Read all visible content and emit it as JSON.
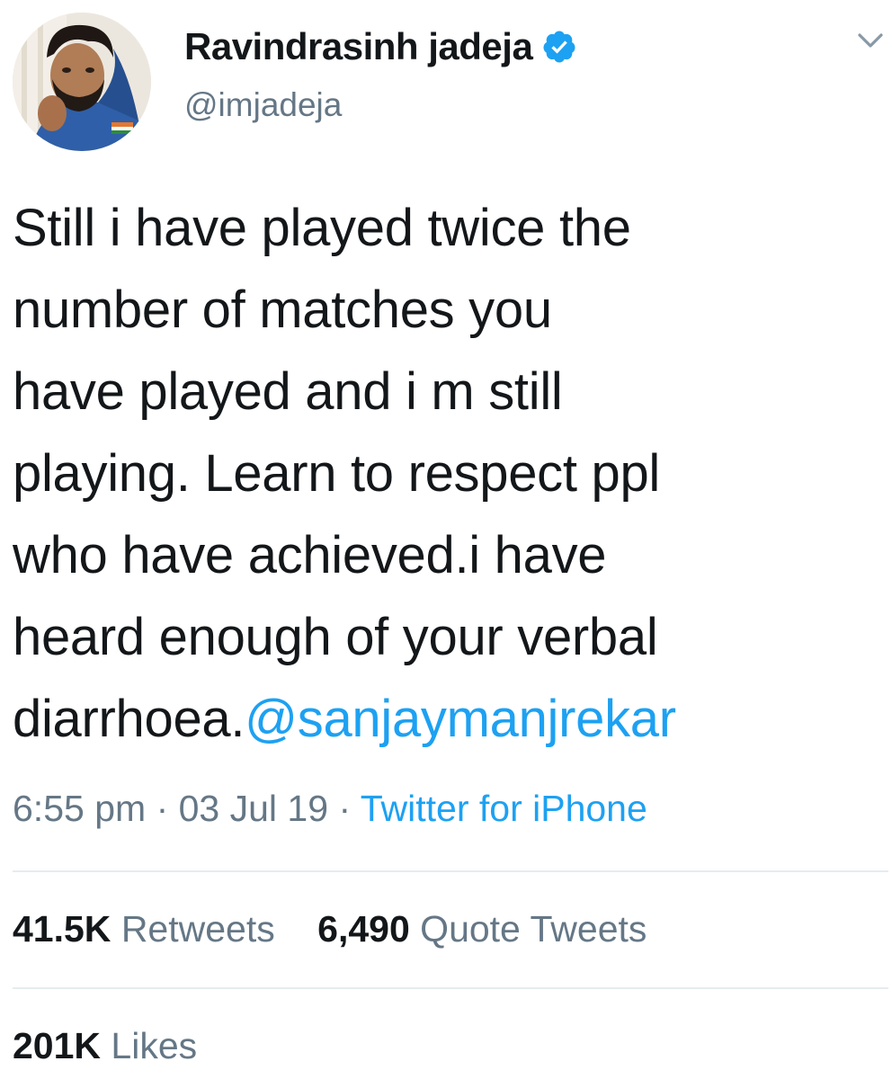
{
  "author": {
    "display_name": "Ravindrasinh jadeja",
    "handle": "@imjadeja",
    "verified": true,
    "avatar_icon": "profile-photo"
  },
  "tweet": {
    "lines": [
      "Still i have played twice the",
      "number of matches you",
      "have played and i m still",
      "playing. Learn to respect ppl",
      "who have achieved.i have",
      "heard enough of your verbal"
    ],
    "last_line_text": "diarrhoea.",
    "mention": "@sanjaymanjrekar"
  },
  "meta": {
    "time": "6:55 pm",
    "separator": "·",
    "date": "03 Jul 19",
    "source": "Twitter for iPhone"
  },
  "stats": {
    "retweets_count": "41.5K",
    "retweets_label": "Retweets",
    "quotes_count": "6,490",
    "quotes_label": "Quote Tweets",
    "likes_count": "201K",
    "likes_label": "Likes"
  },
  "colors": {
    "link": "#1da1f2",
    "secondary_text": "#657786",
    "primary_text": "#14171a",
    "divider": "#e6ecf0"
  }
}
